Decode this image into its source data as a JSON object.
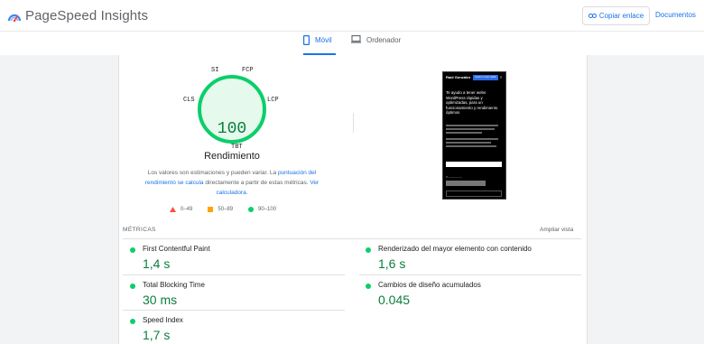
{
  "header": {
    "app_title": "PageSpeed Insights",
    "copy_link_label": "Copiar enlace",
    "docs_label": "Documentos"
  },
  "tabs": [
    {
      "label": "Móvil",
      "active": true
    },
    {
      "label": "Ordenador",
      "active": false
    }
  ],
  "gauge": {
    "score": "100",
    "title": "Rendimiento",
    "metric_tags": [
      "SI",
      "FCP",
      "LCP",
      "TBT",
      "CLS"
    ],
    "color": "#0cce6b",
    "fill_color": "#e6f9ed"
  },
  "description": {
    "text1": "Los valores son estimaciones y pueden variar. La ",
    "link1": "puntuación del rendimiento se calcula",
    "text2": " directamente a partir de estas métricas. ",
    "link2": "Ver calculadora."
  },
  "legend": [
    {
      "range": "0–49",
      "shape": "triangle",
      "color": "#ff4e42"
    },
    {
      "range": "50–89",
      "shape": "square",
      "color": "#ffa400"
    },
    {
      "range": "90–100",
      "shape": "circle",
      "color": "#0cce6b"
    }
  ],
  "screenshot": {
    "name": "Raúl González",
    "button": "Quiero tu web rápida",
    "heading": "Te ayudo a tener webs WordPress rápidas y optimizadas, para un funcionamiento y rendimiento óptimos",
    "cta": "Descargar WPO WordPress"
  },
  "metrics_section": {
    "label": "MÉTRICAS",
    "expand_label": "Ampliar vista",
    "items": [
      {
        "name": "First Contentful Paint",
        "value": "1,4 s"
      },
      {
        "name": "Renderizado del mayor elemento con contenido",
        "value": "1,6 s"
      },
      {
        "name": "Total Blocking Time",
        "value": "30 ms"
      },
      {
        "name": "Cambios de diseño acumulados",
        "value": "0.045"
      },
      {
        "name": "Speed Index",
        "value": "1,7 s"
      }
    ]
  }
}
